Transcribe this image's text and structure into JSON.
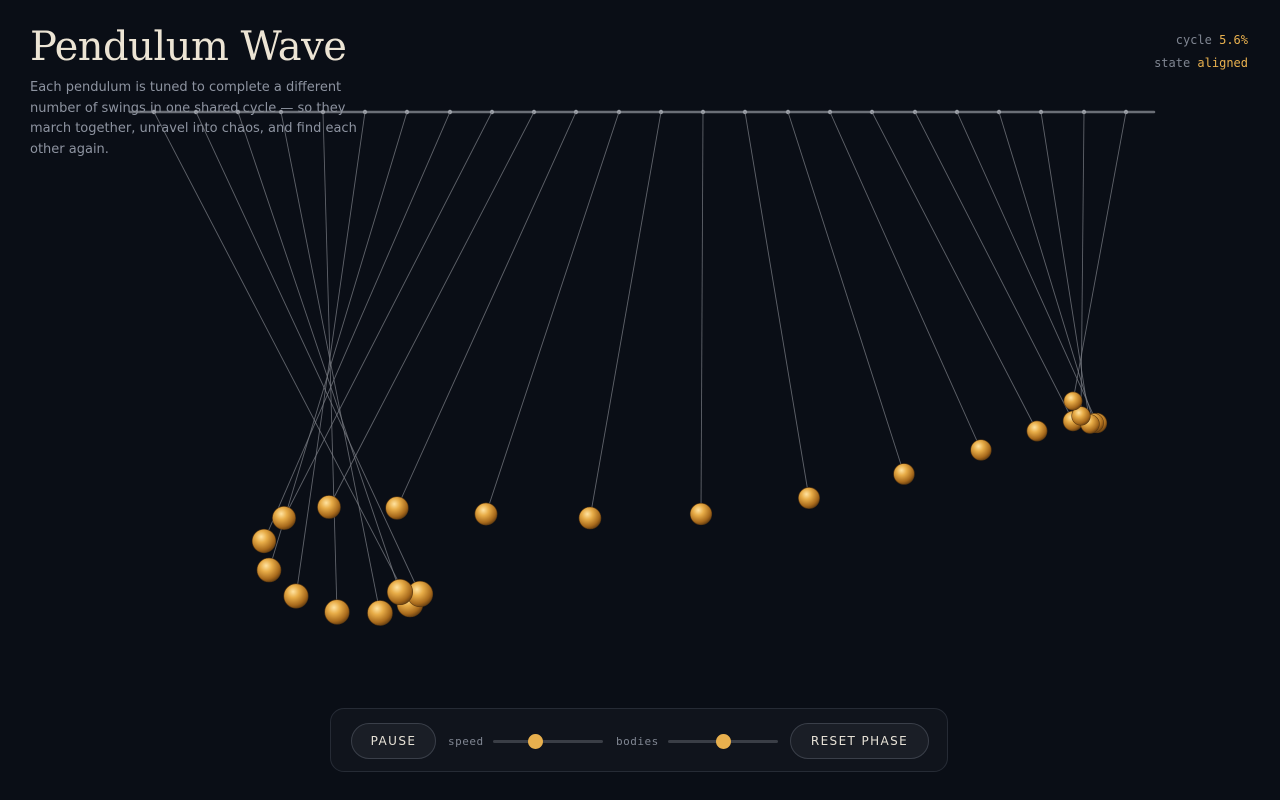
{
  "header": {
    "title": "Pendulum Wave",
    "description": "Each pendulum is tuned to complete a different number of swings in one shared cycle — so they march together, unravel into chaos, and find each other again."
  },
  "status": {
    "cycle_label": "cycle",
    "cycle_value": "5.6%",
    "state_label": "state",
    "state_value": "aligned"
  },
  "controls": {
    "pause_label": "PAUSE",
    "speed_label": "speed",
    "speed_value": 0.38,
    "bodies_label": "bodies",
    "bodies_value": 0.5,
    "reset_label": "RESET PHASE"
  },
  "colors": {
    "background": "#0a0e16",
    "accent": "#e8b04e",
    "bob": "#d49a3a",
    "string": "#7c7f86",
    "rail": "#8a8e96"
  },
  "pendulums": {
    "count": 24,
    "cycle_fraction": 0.056
  }
}
